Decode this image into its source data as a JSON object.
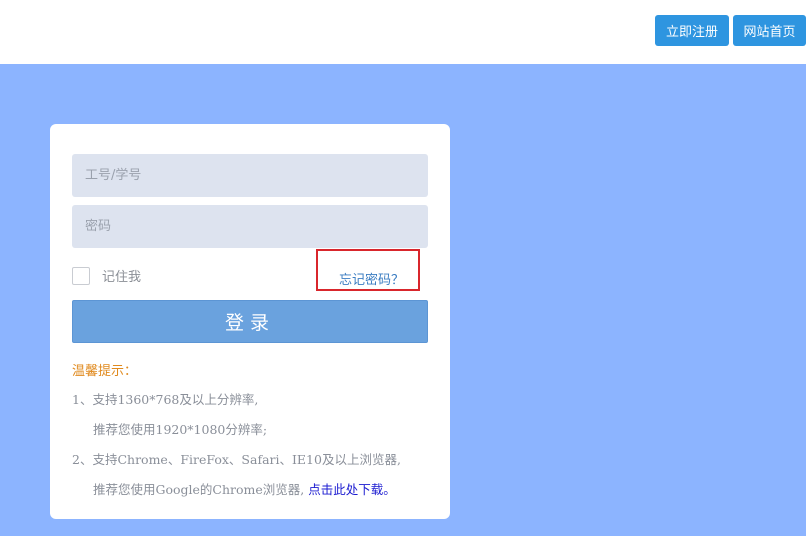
{
  "header": {
    "register_label": "立即注册",
    "home_label": "网站首页"
  },
  "login": {
    "username_placeholder": "工号/学号",
    "password_placeholder": "密码",
    "remember_label": "记住我",
    "forgot_label": "忘记密码？",
    "submit_label": "登录"
  },
  "tips": {
    "title": "温馨提示：",
    "line1": "1、支持1360*768及以上分辨率,",
    "line1b": "推荐您使用1920*1080分辨率;",
    "line2": "2、支持Chrome、FireFox、Safari、IE10及以上浏览器,",
    "line2b_prefix": "推荐您使用Google的Chrome浏览器, ",
    "download_label": "点击此处下载。"
  },
  "colors": {
    "accent": "#2e95e0",
    "stage_background": "#8cb4ff",
    "login_button": "#6aa2de",
    "tips_title": "#e08a1e",
    "highlight_border": "#d9262c"
  }
}
